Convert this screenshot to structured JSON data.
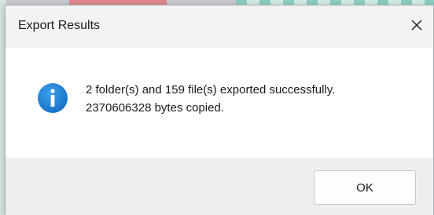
{
  "dialog": {
    "title": "Export Results",
    "close_icon": "close-icon",
    "message_line1": "2 folder(s) and 159 file(s) exported successfully.",
    "message_line2": "2370606328 bytes copied.",
    "icon": "info-icon",
    "ok_label": "OK"
  },
  "colors": {
    "info_icon": "#1e88d9",
    "footer_bg": "#efefef",
    "title_bg": "#f3f3f3"
  }
}
